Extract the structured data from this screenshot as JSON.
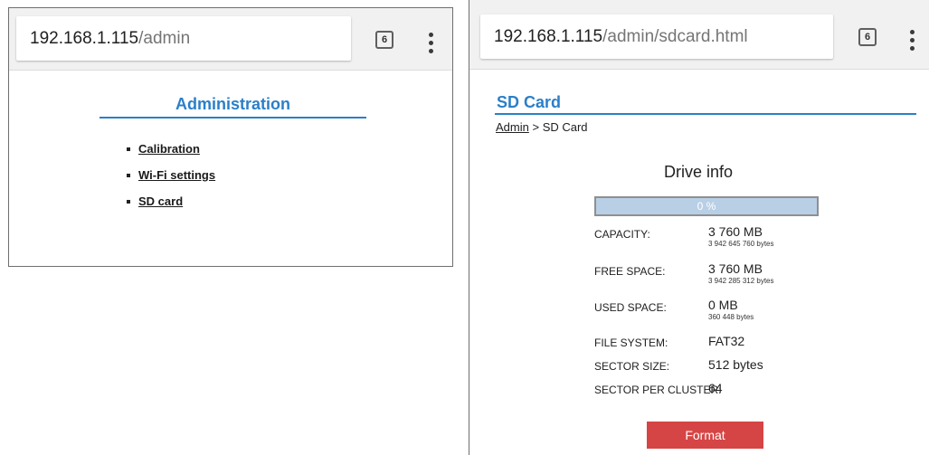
{
  "left": {
    "url_host": "192.168.1.115",
    "url_path": "/admin",
    "tab_count": "6",
    "title": "Administration",
    "links": [
      "Calibration",
      "Wi-Fi settings",
      "SD card"
    ]
  },
  "right": {
    "url_host": "192.168.1.115",
    "url_path": "/admin/sdcard.html",
    "tab_count": "6",
    "title": "SD Card",
    "breadcrumb": {
      "link": "Admin",
      "separator": " > ",
      "current": "SD Card"
    },
    "drive_info_heading": "Drive info",
    "usage_percent": 0,
    "usage_label": "0 %",
    "info": {
      "capacity": {
        "label": "CAPACITY:",
        "value": "3 760 MB",
        "sub": "3 942 645 760 bytes"
      },
      "free_space": {
        "label": "FREE SPACE:",
        "value": "3 760 MB",
        "sub": "3 942 285 312 bytes"
      },
      "used_space": {
        "label": "USED SPACE:",
        "value": "0 MB",
        "sub": "360 448 bytes"
      },
      "file_system": {
        "label": "FILE SYSTEM:",
        "value": "FAT32"
      },
      "sector_size": {
        "label": "SECTOR SIZE:",
        "value": "512 bytes"
      },
      "sector_per_cluster": {
        "label": "SECTOR PER CLUSTER:",
        "value": "64"
      }
    },
    "format_label": "Format"
  },
  "colors": {
    "accent": "#2b7fc9",
    "format_button": "#d64545",
    "progress_fill": "#b9cfe6"
  },
  "icons": [
    "tab-switcher-icon",
    "overflow-menu-icon",
    "bullet-icon"
  ]
}
